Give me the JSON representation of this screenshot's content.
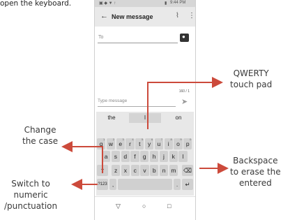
{
  "intro": {
    "text": "open the keyboard."
  },
  "status": {
    "time": "9:44 PM"
  },
  "appbar": {
    "title": "New message"
  },
  "to_field": {
    "placeholder": "To"
  },
  "compose": {
    "placeholder": "Type message",
    "counter": "160 / 1"
  },
  "keyboard": {
    "suggestions": [
      "the",
      "I",
      "on"
    ],
    "rows": [
      [
        {
          "k": "q",
          "h": "1"
        },
        {
          "k": "w",
          "h": "2"
        },
        {
          "k": "e",
          "h": "3"
        },
        {
          "k": "r",
          "h": "4"
        },
        {
          "k": "t",
          "h": "5"
        },
        {
          "k": "y",
          "h": "6"
        },
        {
          "k": "u",
          "h": "7"
        },
        {
          "k": "i",
          "h": "8"
        },
        {
          "k": "o",
          "h": "9"
        },
        {
          "k": "p",
          "h": "0"
        }
      ],
      [
        {
          "k": "a"
        },
        {
          "k": "s"
        },
        {
          "k": "d"
        },
        {
          "k": "f"
        },
        {
          "k": "g"
        },
        {
          "k": "h"
        },
        {
          "k": "j"
        },
        {
          "k": "k"
        },
        {
          "k": "l"
        }
      ],
      [
        {
          "k": "z"
        },
        {
          "k": "x"
        },
        {
          "k": "c"
        },
        {
          "k": "v"
        },
        {
          "k": "b"
        },
        {
          "k": "n"
        },
        {
          "k": "m"
        }
      ]
    ],
    "shift": "⇧",
    "backspace": "⌫",
    "numeric": "?123",
    "comma": ",",
    "period": ".",
    "enter": "↵"
  },
  "nav": {
    "back": "▽",
    "home": "○",
    "recents": "□"
  },
  "annotations": {
    "qwerty": [
      "QWERTY",
      "touch pad"
    ],
    "change_case": [
      "Change",
      "the case"
    ],
    "backspace": [
      "Backspace",
      "to erase the",
      "entered"
    ],
    "numeric": [
      "Switch to",
      "numeric",
      "/punctuation"
    ]
  },
  "colors": {
    "arrow": "#cc4a3b",
    "keyboard_bg": "#e8e8e8",
    "key": "#d0d0d0"
  },
  "icons": {
    "back": "arrow-left-icon",
    "attach": "paperclip-icon",
    "menu": "kebab-menu-icon",
    "send": "send-icon"
  }
}
